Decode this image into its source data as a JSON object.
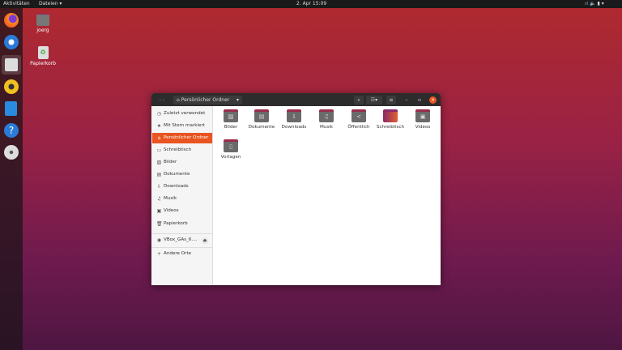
{
  "topbar": {
    "activities": "Aktivitäten",
    "app_menu": "Dateien ▾",
    "clock": "2. Apr  15:09",
    "tray": "⛙ 🔈 ▮ ▾"
  },
  "dock": {
    "items": [
      "firefox",
      "thunderbird",
      "files",
      "rhythmbox",
      "writer",
      "help",
      "cd-drive"
    ],
    "active": "files"
  },
  "desktop": {
    "icons": [
      {
        "label": "joerg",
        "icon": "home-folder-icon"
      },
      {
        "label": "Papierkorb",
        "icon": "trash-icon"
      }
    ]
  },
  "window": {
    "location": "Persönlicher Ordner",
    "sidebar": [
      {
        "label": "Zuletzt verwendet",
        "icon": "◷"
      },
      {
        "label": "Mit Stern markiert",
        "icon": "★"
      },
      {
        "label": "Persönlicher Ordner",
        "icon": "⌂",
        "selected": true
      },
      {
        "label": "Schreibtisch",
        "icon": "▭"
      },
      {
        "label": "Bilder",
        "icon": "▨"
      },
      {
        "label": "Dokumente",
        "icon": "▤"
      },
      {
        "label": "Downloads",
        "icon": "⇩"
      },
      {
        "label": "Musik",
        "icon": "♫"
      },
      {
        "label": "Videos",
        "icon": "▣"
      },
      {
        "label": "Papierkorb",
        "icon": "🗑"
      }
    ],
    "device": {
      "label": "VBox_GAs_6....",
      "eject": "⏏",
      "icon": "◉"
    },
    "other": {
      "label": "Andere Orte",
      "icon": "+"
    },
    "files": [
      {
        "label": "Bilder",
        "glyph": "▨"
      },
      {
        "label": "Dokumente",
        "glyph": "▤"
      },
      {
        "label": "Downloads",
        "glyph": "⇩"
      },
      {
        "label": "Musik",
        "glyph": "♫"
      },
      {
        "label": "Öffentlich",
        "glyph": "<"
      },
      {
        "label": "Schreibtisch",
        "glyph": ""
      },
      {
        "label": "Videos",
        "glyph": "▣"
      },
      {
        "label": "Vorlagen",
        "glyph": "▯"
      }
    ]
  }
}
